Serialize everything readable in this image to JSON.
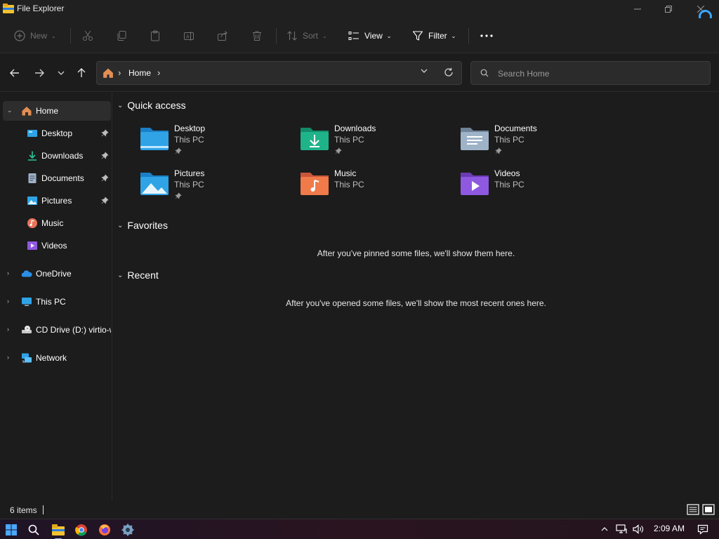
{
  "window": {
    "title": "File Explorer"
  },
  "toolbar": {
    "new_label": "New",
    "sort_label": "Sort",
    "view_label": "View",
    "filter_label": "Filter"
  },
  "address": {
    "location": "Home"
  },
  "search": {
    "placeholder": "Search Home",
    "value": ""
  },
  "sidebar": {
    "items": [
      {
        "label": "Home",
        "icon": "home-icon"
      },
      {
        "label": "Desktop",
        "icon": "desktop-folder-icon"
      },
      {
        "label": "Downloads",
        "icon": "downloads-icon"
      },
      {
        "label": "Documents",
        "icon": "documents-icon"
      },
      {
        "label": "Pictures",
        "icon": "pictures-icon"
      },
      {
        "label": "Music",
        "icon": "music-icon"
      },
      {
        "label": "Videos",
        "icon": "videos-icon"
      },
      {
        "label": "OneDrive",
        "icon": "onedrive-icon"
      },
      {
        "label": "This PC",
        "icon": "this-pc-icon"
      },
      {
        "label": "CD Drive (D:) virtio-w",
        "icon": "cd-drive-icon"
      },
      {
        "label": "Network",
        "icon": "network-icon"
      }
    ]
  },
  "main": {
    "quick_access": {
      "heading": "Quick access",
      "tiles": [
        {
          "name": "Desktop",
          "location": "This PC",
          "pinned": true,
          "icon": "desktop-folder-icon"
        },
        {
          "name": "Downloads",
          "location": "This PC",
          "pinned": true,
          "icon": "downloads-folder-icon"
        },
        {
          "name": "Documents",
          "location": "This PC",
          "pinned": true,
          "icon": "documents-folder-icon"
        },
        {
          "name": "Pictures",
          "location": "This PC",
          "pinned": true,
          "icon": "pictures-folder-icon"
        },
        {
          "name": "Music",
          "location": "This PC",
          "pinned": false,
          "icon": "music-folder-icon"
        },
        {
          "name": "Videos",
          "location": "This PC",
          "pinned": false,
          "icon": "videos-folder-icon"
        }
      ]
    },
    "favorites": {
      "heading": "Favorites",
      "empty_message": "After you've pinned some files, we'll show them here."
    },
    "recent": {
      "heading": "Recent",
      "empty_message": "After you've opened some files, we'll show the most recent ones here."
    }
  },
  "status": {
    "item_count": "6 items"
  },
  "taskbar": {
    "clock": "2:09 AM",
    "apps": [
      "start-icon",
      "search-icon",
      "file-explorer-icon",
      "chrome-icon",
      "firefox-icon",
      "settings-icon"
    ]
  },
  "colors": {
    "background": "#1c1c1c",
    "chrome": "#202020",
    "accent": "#3aa7ff",
    "folder_blue": "#2fa3e6",
    "folder_teal": "#1fb38a",
    "folder_gray": "#9fb3c8",
    "folder_orange": "#f07a4a",
    "folder_purple": "#8f58e0"
  }
}
